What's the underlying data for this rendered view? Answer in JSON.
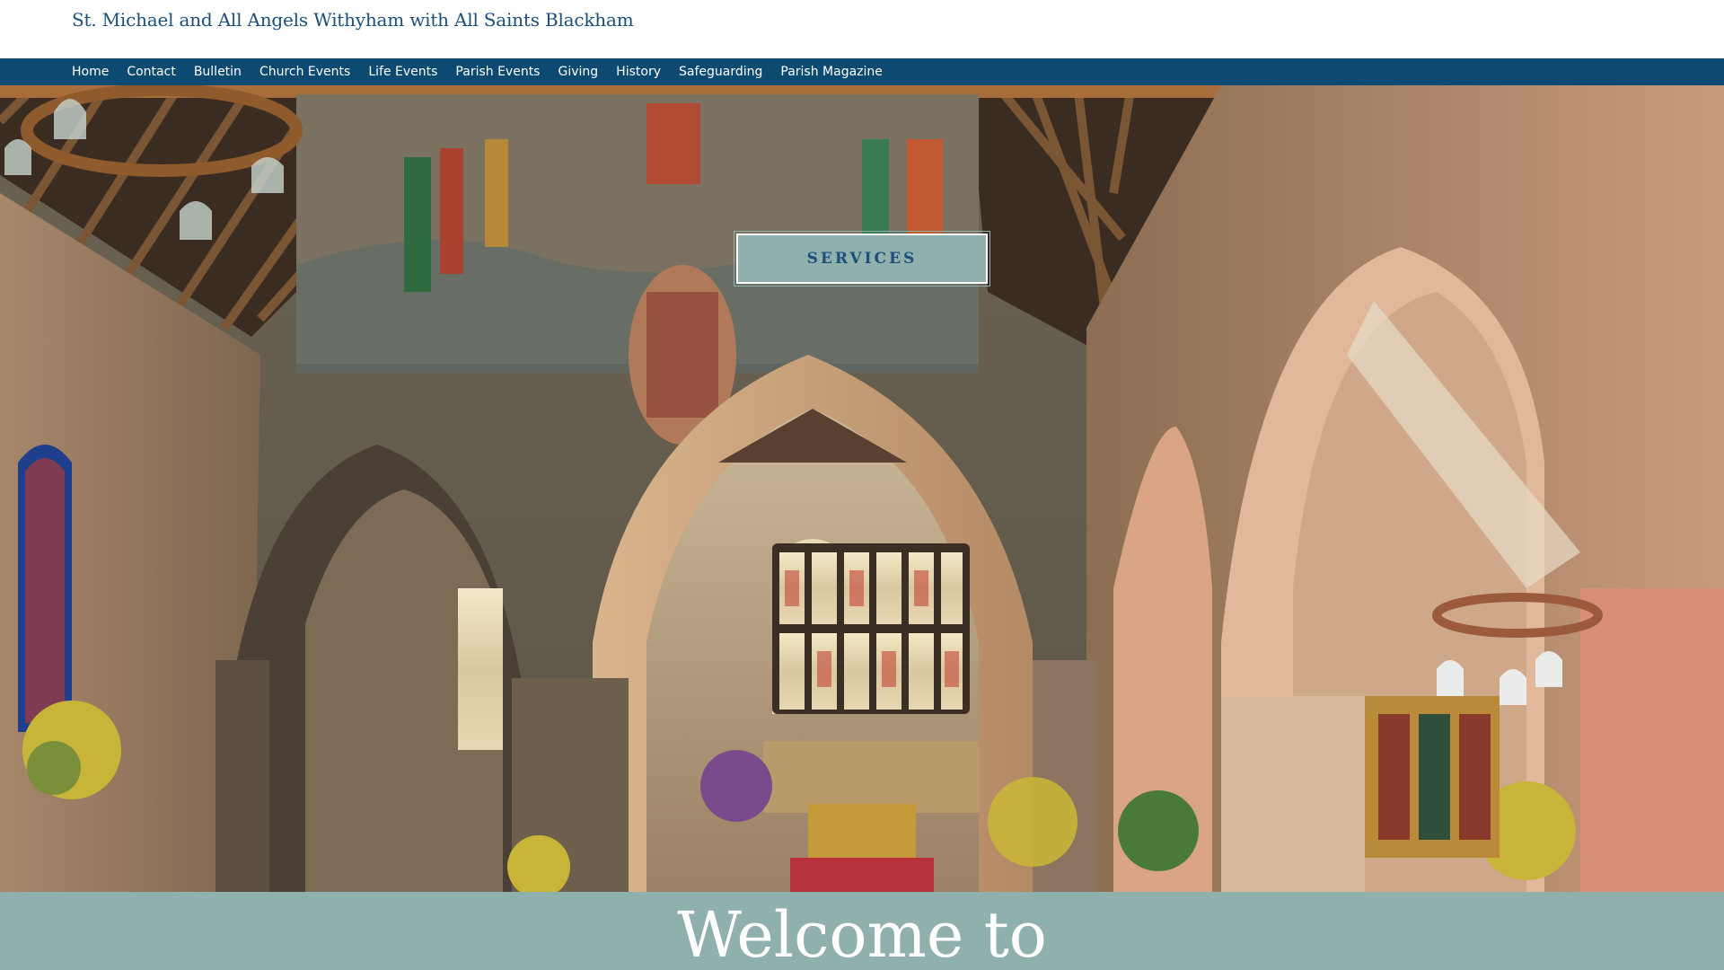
{
  "header": {
    "site_title": "St. Michael and All Angels Withyham with All Saints Blackham"
  },
  "nav": {
    "items": [
      {
        "label": "Home"
      },
      {
        "label": "Contact"
      },
      {
        "label": "Bulletin"
      },
      {
        "label": "Church Events"
      },
      {
        "label": "Life Events"
      },
      {
        "label": "Parish Events"
      },
      {
        "label": "Giving"
      },
      {
        "label": "History"
      },
      {
        "label": "Safeguarding"
      },
      {
        "label": "Parish Magazine"
      }
    ]
  },
  "hero": {
    "services_button_label": "SERVICES"
  },
  "welcome": {
    "heading": "Welcome to"
  },
  "colors": {
    "nav_background": "#0d4a72",
    "title_text": "#1d4f7a",
    "accent_teal": "#8fb0ad"
  }
}
